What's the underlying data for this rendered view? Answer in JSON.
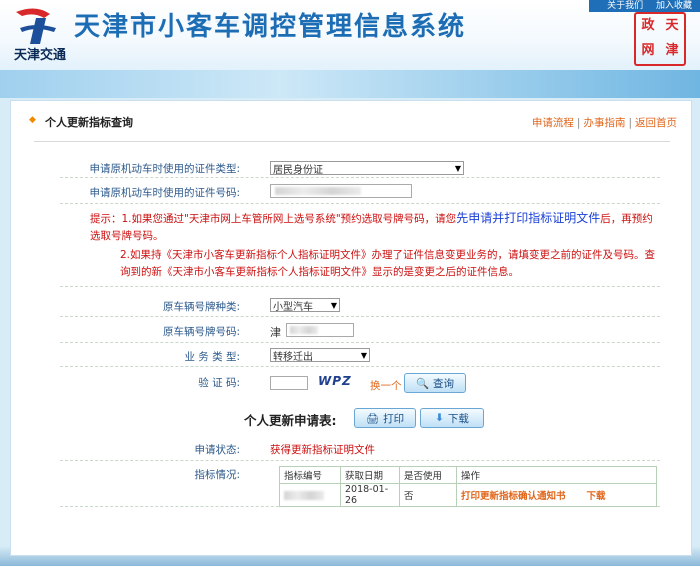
{
  "header": {
    "title": "天津市小客车调控管理信息系统",
    "logo_text": "天津交通",
    "top_links": [
      "关于我们",
      "加入收藏"
    ],
    "seal_text": [
      "天",
      "津",
      "政",
      "网"
    ]
  },
  "panel": {
    "title": "个人更新指标查询",
    "links": [
      "申请流程",
      "办事指南",
      "返回首页"
    ]
  },
  "form": {
    "id_type_label": "申请原机动车时使用的证件类型:",
    "id_type_value": "居民身份证",
    "id_number_label": "申请原机动车时使用的证件号码:",
    "notice_prefix": "提示：1.如果您通过\"天津市网上车管所网上选号系统\"预约选取号牌号码，请您",
    "notice_blue": "先申请并打印指标证明文件",
    "notice_suffix": "后，再预约选取号牌号码。",
    "notice_2": "2.如果持《天津市小客车更新指标个人指标证明文件》办理了证件信息变更业务的，请填变更之前的证件及号码。查询到的新《天津市小客车更新指标个人指标证明文件》显示的是变更之后的证件信息。",
    "plate_type_label": "原车辆号牌种类:",
    "plate_type_value": "小型汽车",
    "plate_number_label": "原车辆号牌号码:",
    "plate_prefix": "津",
    "business_type_label": "业 务 类 型:",
    "business_type_value": "转移迁出",
    "captcha_label": "验 证 码:",
    "captcha_image_text": "WPZ",
    "captcha_refresh": "换一个",
    "query_button": "查询"
  },
  "result": {
    "heading": "个人更新申请表:",
    "print_button": "打印",
    "download_button": "下载",
    "status_label": "申请状态:",
    "status_value": "获得更新指标证明文件",
    "quota_label": "指标情况:",
    "table_headers": [
      "指标编号",
      "获取日期",
      "是否使用",
      "操作"
    ],
    "table_row": {
      "date": "2018-01-26",
      "used": "否",
      "action_print": "打印更新指标确认通知书",
      "action_download": "下载"
    }
  }
}
